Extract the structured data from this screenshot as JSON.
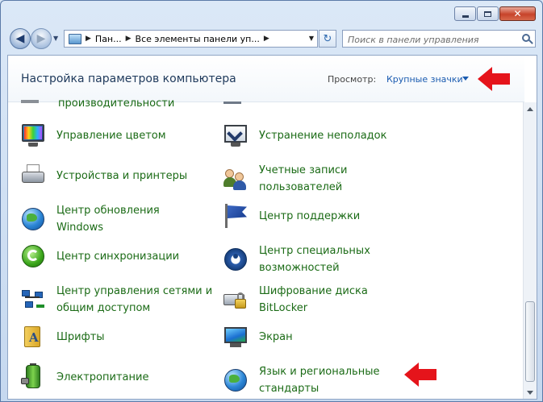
{
  "window": {
    "minimize_icon": "minimize-icon",
    "maximize_icon": "maximize-icon",
    "close_icon": "close-icon"
  },
  "nav": {
    "back_glyph": "◀",
    "forward_glyph": "▶",
    "address_crumbs": [
      "Пан...",
      "Все элементы панели уп..."
    ],
    "search_placeholder": "Поиск в панели управления"
  },
  "header": {
    "title": "Настройка параметров компьютера",
    "view_label": "Просмотр:",
    "view_value": "Крупные значки"
  },
  "partial_items": {
    "left": "производительности"
  },
  "items": {
    "left": [
      {
        "label": "Управление цветом",
        "icon": "color-management-icon"
      },
      {
        "label": "Устройства и принтеры",
        "icon": "printer-icon"
      },
      {
        "label": "Центр обновления Windows",
        "icon": "windows-update-icon"
      },
      {
        "label": "Центр синхронизации",
        "icon": "sync-center-icon"
      },
      {
        "label": "Центр управления сетями и общим доступом",
        "icon": "network-icon"
      },
      {
        "label": "Шрифты",
        "icon": "fonts-icon"
      },
      {
        "label": "Электропитание",
        "icon": "power-options-icon"
      }
    ],
    "right": [
      {
        "label": "Устранение неполадок",
        "icon": "troubleshooting-icon"
      },
      {
        "label": "Учетные записи пользователей",
        "icon": "user-accounts-icon"
      },
      {
        "label": "Центр поддержки",
        "icon": "action-center-flag-icon"
      },
      {
        "label": "Центр специальных возможностей",
        "icon": "ease-of-access-icon"
      },
      {
        "label": "Шифрование диска BitLocker",
        "icon": "bitlocker-icon"
      },
      {
        "label": "Экран",
        "icon": "display-icon"
      },
      {
        "label": "Язык и региональные стандарты",
        "icon": "region-language-icon"
      }
    ]
  },
  "annotations": {
    "arrow_color": "#e5141b"
  }
}
